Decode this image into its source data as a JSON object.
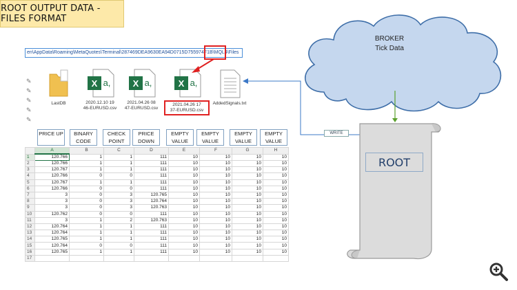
{
  "title": "ROOT OUTPUT DATA - FILES FORMAT",
  "explorer": {
    "path": "en\\AppData\\Roaming\\MetaQuotes\\Terminal\\287469DEA9630EA94D0715D755974F1B\\MQL4\\Files",
    "files": [
      {
        "name": "LastDB",
        "icon": "folder-icon"
      },
      {
        "name": "2020.12.10 19\n46-EURUSD.csv",
        "icon": "excel-csv-icon"
      },
      {
        "name": "2021.04.26 08\n47-EURUSD.csv",
        "icon": "excel-csv-icon"
      },
      {
        "name": "2021.04.26 17\n37-EURUSD.csv",
        "icon": "excel-csv-icon"
      },
      {
        "name": "AddedSignals.txt",
        "icon": "text-file-icon"
      }
    ]
  },
  "broker": {
    "line1": "BROKER",
    "line2": "Tick Data"
  },
  "write_label": "WRITE",
  "root_label": "ROOT",
  "colors": {
    "title_bg": "#fde9a9",
    "highlight": "#e02020",
    "excel_green": "#217346",
    "arrow": "#3b78c7",
    "feed_arrow": "#5aa02c"
  },
  "sheet": {
    "field_labels": [
      "PRICE UP",
      "BINARY CODE",
      "CHECK POINT",
      "PRICE DOWN",
      "EMPTY VALUE",
      "EMPTY VALUE",
      "EMPTY VALUE",
      "EMPTY VALUE"
    ],
    "columns": [
      "A",
      "B",
      "C",
      "D",
      "E",
      "F",
      "G",
      "H"
    ],
    "rows": [
      [
        "1",
        "120.766",
        "1",
        "1",
        "111",
        "10",
        "10",
        "10",
        "10"
      ],
      [
        "2",
        "120.766",
        "1",
        "1",
        "111",
        "10",
        "10",
        "10",
        "10"
      ],
      [
        "3",
        "120.767",
        "1",
        "1",
        "111",
        "10",
        "10",
        "10",
        "10"
      ],
      [
        "4",
        "120.766",
        "0",
        "0",
        "111",
        "10",
        "10",
        "10",
        "10"
      ],
      [
        "5",
        "120.767",
        "1",
        "1",
        "111",
        "10",
        "10",
        "10",
        "10"
      ],
      [
        "6",
        "120.766",
        "0",
        "0",
        "111",
        "10",
        "10",
        "10",
        "10"
      ],
      [
        "7",
        "3",
        "0",
        "3",
        "120.765",
        "10",
        "10",
        "10",
        "10"
      ],
      [
        "8",
        "3",
        "0",
        "3",
        "120.764",
        "10",
        "10",
        "10",
        "10"
      ],
      [
        "9",
        "3",
        "0",
        "3",
        "120.763",
        "10",
        "10",
        "10",
        "10"
      ],
      [
        "10",
        "120.762",
        "0",
        "0",
        "111",
        "10",
        "10",
        "10",
        "10"
      ],
      [
        "11",
        "3",
        "1",
        "2",
        "120.763",
        "10",
        "10",
        "10",
        "10"
      ],
      [
        "12",
        "120.764",
        "1",
        "1",
        "111",
        "10",
        "10",
        "10",
        "10"
      ],
      [
        "13",
        "120.764",
        "1",
        "1",
        "111",
        "10",
        "10",
        "10",
        "10"
      ],
      [
        "14",
        "120.765",
        "1",
        "1",
        "111",
        "10",
        "10",
        "10",
        "10"
      ],
      [
        "15",
        "120.764",
        "0",
        "0",
        "111",
        "10",
        "10",
        "10",
        "10"
      ],
      [
        "16",
        "120.765",
        "1",
        "1",
        "111",
        "10",
        "10",
        "10",
        "10"
      ],
      [
        "17",
        "",
        "",
        "",
        "",
        "",
        "",
        "",
        ""
      ]
    ]
  }
}
